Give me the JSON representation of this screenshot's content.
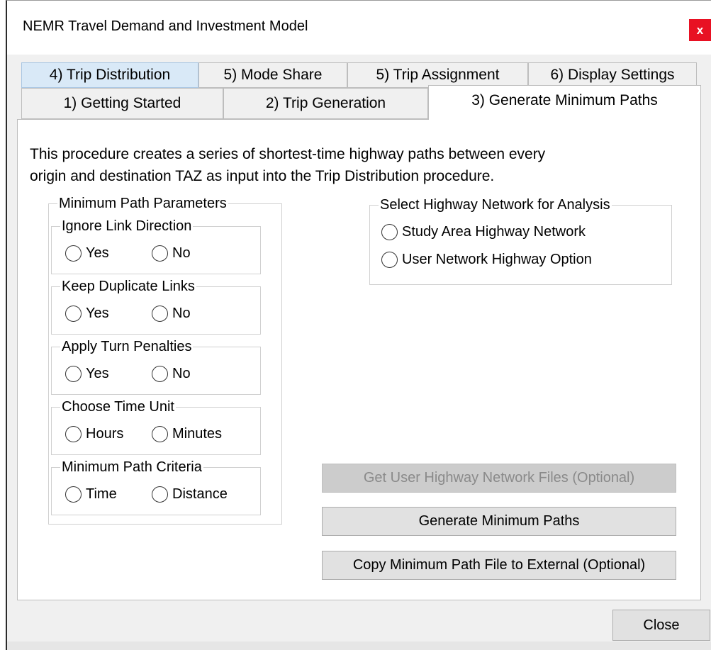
{
  "window": {
    "title": "NEMR Travel Demand and Investment Model",
    "close_glyph": "x"
  },
  "tabs_row_top": [
    {
      "label": "4) Trip Distribution"
    },
    {
      "label": "5) Mode Share"
    },
    {
      "label": "5) Trip Assignment"
    },
    {
      "label": "6) Display Settings"
    }
  ],
  "tabs_row_bottom": [
    {
      "label": "1) Getting Started"
    },
    {
      "label": "2) Trip Generation"
    },
    {
      "label": "3) Generate Minimum Paths"
    }
  ],
  "active_tab": "3) Generate Minimum Paths",
  "panel": {
    "description_line1": "This procedure creates a series of shortest-time highway paths between every",
    "description_line2": "origin and destination TAZ as input into the Trip Distribution procedure.",
    "min_path_params": {
      "legend": "Minimum Path Parameters",
      "groups": [
        {
          "legend": "Ignore Link Direction",
          "options": [
            "Yes",
            "No"
          ]
        },
        {
          "legend": "Keep Duplicate Links",
          "options": [
            "Yes",
            "No"
          ]
        },
        {
          "legend": "Apply Turn Penalties",
          "options": [
            "Yes",
            "No"
          ]
        },
        {
          "legend": "Choose Time Unit",
          "options": [
            "Hours",
            "Minutes"
          ]
        },
        {
          "legend": "Minimum Path Criteria",
          "options": [
            "Time",
            "Distance"
          ]
        }
      ]
    },
    "network_select": {
      "legend": "Select Highway Network for Analysis",
      "options": [
        "Study Area Highway Network",
        "User Network Highway Option"
      ]
    },
    "buttons": {
      "get_user_files": "Get User Highway Network Files (Optional)",
      "generate": "Generate Minimum Paths",
      "copy_external": "Copy Minimum Path File to External (Optional)"
    }
  },
  "footer": {
    "close_label": "Close"
  },
  "colors": {
    "close_red": "#e81123",
    "tab_highlight": "#d9e9f7",
    "dialog_bg": "#f0f0f0"
  }
}
